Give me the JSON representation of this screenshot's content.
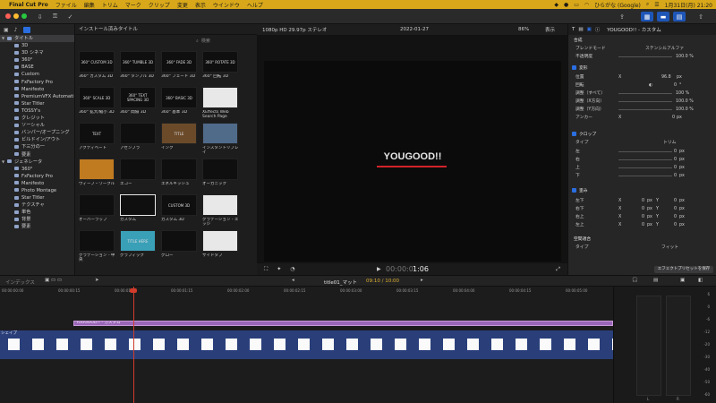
{
  "menubar": {
    "app": "Final Cut Pro",
    "items": [
      "ファイル",
      "編集",
      "トリム",
      "マーク",
      "クリップ",
      "変更",
      "表示",
      "ウインドウ",
      "ヘルプ"
    ],
    "input_source": "ひらがな (Google)",
    "clock": "1月31日(月) 21:20"
  },
  "sidebar": {
    "items": [
      {
        "label": "タイトル",
        "level": 0,
        "expanded": true,
        "selected": true
      },
      {
        "label": "3D",
        "level": 1
      },
      {
        "label": "3D シネマ",
        "level": 1
      },
      {
        "label": "360°",
        "level": 1
      },
      {
        "label": "BASE",
        "level": 1
      },
      {
        "label": "Custom",
        "level": 1
      },
      {
        "label": "FxFactory Pro",
        "level": 1
      },
      {
        "label": "Manifesto",
        "level": 1
      },
      {
        "label": "PremiumVFX Automati...",
        "level": 1
      },
      {
        "label": "Star Titler",
        "level": 1
      },
      {
        "label": "TOSSY's",
        "level": 1
      },
      {
        "label": "クレジット",
        "level": 1
      },
      {
        "label": "ソーシャル",
        "level": 1
      },
      {
        "label": "バンパー/オープニング",
        "level": 1
      },
      {
        "label": "ビルドイン/アウト",
        "level": 1
      },
      {
        "label": "下三分の一",
        "level": 1
      },
      {
        "label": "要素",
        "level": 1
      },
      {
        "label": "ジェネレータ",
        "level": 0,
        "expanded": true
      },
      {
        "label": "360°",
        "level": 1
      },
      {
        "label": "FxFactory Pro",
        "level": 1
      },
      {
        "label": "Manifesto",
        "level": 1
      },
      {
        "label": "Photo Montage",
        "level": 1
      },
      {
        "label": "Star Titler",
        "level": 1
      },
      {
        "label": "テクスチャ",
        "level": 1
      },
      {
        "label": "単色",
        "level": 1
      },
      {
        "label": "背景",
        "level": 1
      },
      {
        "label": "要素",
        "level": 1
      }
    ]
  },
  "browser": {
    "header": "インストール済みタイトル",
    "search_placeholder": "検索",
    "tiles": [
      {
        "label": "360° カスタム 3D",
        "thumb": "360° CUSTOM 3D"
      },
      {
        "label": "360° タンブル 3D",
        "thumb": "360° TUMBLE 3D"
      },
      {
        "label": "360° フェード 3D",
        "thumb": "360° FADE 3D"
      },
      {
        "label": "360° 回転 3D",
        "thumb": "360° ROTATE 3D"
      },
      {
        "label": "360° 拡大/縮小 3D",
        "thumb": "360° SCALE 3D"
      },
      {
        "label": "360° 間隔 3D",
        "thumb": "360° TEXT SPACING 3D"
      },
      {
        "label": "360° 基本 3D",
        "thumb": "360° BASIC 3D"
      },
      {
        "label": "XEffects Web Search Page",
        "thumb": ""
      },
      {
        "label": "アクティベート",
        "thumb": "TEXT"
      },
      {
        "label": "アセンブラ",
        "thumb": ""
      },
      {
        "label": "インク",
        "thumb": "TITLE"
      },
      {
        "label": "インスタントリプレイ",
        "thumb": ""
      },
      {
        "label": "ウィーブ・ワークル",
        "thumb": ""
      },
      {
        "label": "エコー",
        "thumb": ""
      },
      {
        "label": "エネルギッシュ",
        "thumb": ""
      },
      {
        "label": "オーガニック",
        "thumb": ""
      },
      {
        "label": "オーバーラップ",
        "thumb": ""
      },
      {
        "label": "カスタム",
        "thumb": ""
      },
      {
        "label": "カスタム 3D",
        "thumb": "CUSTOM 3D"
      },
      {
        "label": "グラデーション - エッジ",
        "thumb": ""
      },
      {
        "label": "グラデーション - 中央",
        "thumb": ""
      },
      {
        "label": "グラフィック",
        "thumb": "TITLE HERE"
      },
      {
        "label": "グロー",
        "thumb": ""
      },
      {
        "label": "サイドタブ",
        "thumb": ""
      }
    ]
  },
  "viewer": {
    "format": "1080p HD 29.97p ステレオ",
    "date": "2022-01-27",
    "zoom": "86%",
    "view_label": "表示",
    "title_text": "YOUGOOD!!",
    "timecode_prefix": "00:00:0",
    "timecode_main": "1:06"
  },
  "inspector": {
    "title": "YOUGOOD!! - カスタム",
    "section_composite": "合成",
    "blend_mode_label": "ブレンドモード",
    "blend_mode_value": "ステンシルアルファ",
    "opacity_label": "不透明度",
    "opacity_value": "100.0 %",
    "section_transform": "変形",
    "position_label": "位置",
    "position_x": "X",
    "position_x_value": "96.8",
    "px": "px",
    "rotation_label": "回転",
    "rotation_value": "0",
    "degree": "°",
    "scale_all_label": "調整（すべて）",
    "scale_all_value": "100 %",
    "scale_x_label": "調整（X方向）",
    "scale_x_value": "100.0 %",
    "scale_y_label": "調整（Y方向）",
    "scale_y_value": "100.0 %",
    "anchor_label": "アンカー",
    "anchor_x": "X",
    "anchor_value": "0",
    "section_crop": "クロップ",
    "crop_type_label": "タイプ",
    "crop_type_value": "トリム",
    "crop_left_label": "左",
    "crop_right_label": "右",
    "crop_top_label": "上",
    "crop_bottom_label": "下",
    "crop_value": "0",
    "section_distort": "歪み",
    "bl_label": "左下",
    "br_label": "右下",
    "tr_label": "右上",
    "tl_label": "左上",
    "axis_x": "X",
    "axis_y": "Y",
    "zero": "0",
    "section_spatial": "空間適合",
    "spatial_type_label": "タイプ",
    "spatial_type_value": "フィット",
    "save_preset_button": "エフェクトプリセットを保存"
  },
  "timeline_bar": {
    "index_label": "インデックス",
    "project_name": "title01_マット",
    "duration": "09:10 / 10:00"
  },
  "timeline": {
    "title_clip": "YOUGOOD!! - カスタム",
    "shape_clip": "シェイプ",
    "ruler_ticks": [
      "00:00:00:00",
      "00:00:00:15",
      "00:00:01:00",
      "00:00:01:15",
      "00:00:02:00",
      "00:00:02:15",
      "00:00:03:00",
      "00:00:03:15",
      "00:00:04:00",
      "00:00:04:15",
      "00:00:05:00"
    ]
  },
  "meters": {
    "scale": [
      "6",
      "0",
      "-6",
      "-12",
      "-20",
      "-30",
      "-40",
      "-50",
      "-60"
    ],
    "left": "L",
    "right": "R"
  },
  "colors": {
    "menubar": "#d8a81a",
    "accent": "#1e56b8",
    "title_clip": "#9a66b8",
    "shape_clip": "#2a3f7a",
    "playhead": "#d13c2c",
    "underline": "#d3222a"
  }
}
